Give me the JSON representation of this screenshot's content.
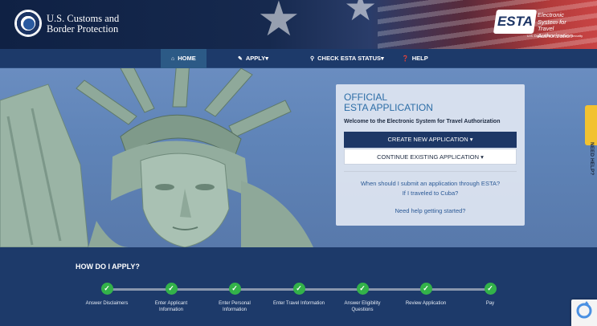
{
  "header": {
    "agency_line1": "U.S. Customs and",
    "agency_line2": "Border Protection",
    "esta_logo_text": "ESTA",
    "esta_desc_line1": "Electronic System for",
    "esta_desc_line2": "Travel Authorization",
    "esta_dept": "U.S. Department of Homeland Security"
  },
  "nav": {
    "items": [
      {
        "label": "HOME",
        "icon": "home-icon"
      },
      {
        "label": "APPLY",
        "icon": "pencil-icon"
      },
      {
        "label": "CHECK ESTA STATUS",
        "icon": "search-icon"
      },
      {
        "label": "HELP",
        "icon": "question-icon"
      }
    ]
  },
  "card": {
    "title_line1": "OFFICIAL",
    "title_line2": "ESTA APPLICATION",
    "welcome": "Welcome to the Electronic System for Travel Authorization",
    "create_button": "CREATE NEW APPLICATION",
    "continue_button": "CONTINUE EXISTING APPLICATION",
    "link1": "When should I submit an application through ESTA?",
    "link2": "If I traveled to Cuba?",
    "link3": "Need help getting started?"
  },
  "need_help_tab": "NEED HELP?",
  "steps": {
    "title": "HOW DO I APPLY?",
    "items": [
      {
        "line1": "Answer Disclaimers",
        "line2": ""
      },
      {
        "line1": "Enter Applicant",
        "line2": "Information"
      },
      {
        "line1": "Enter Personal",
        "line2": "Information"
      },
      {
        "line1": "Enter Travel Information",
        "line2": ""
      },
      {
        "line1": "Answer Eligibility",
        "line2": "Questions"
      },
      {
        "line1": "Review Application",
        "line2": ""
      },
      {
        "line1": "Pay",
        "line2": ""
      }
    ]
  },
  "colors": {
    "navy": "#1d3a6a",
    "accent_blue": "#2c6da6",
    "step_green": "#33b249",
    "help_yellow": "#f2c230"
  }
}
